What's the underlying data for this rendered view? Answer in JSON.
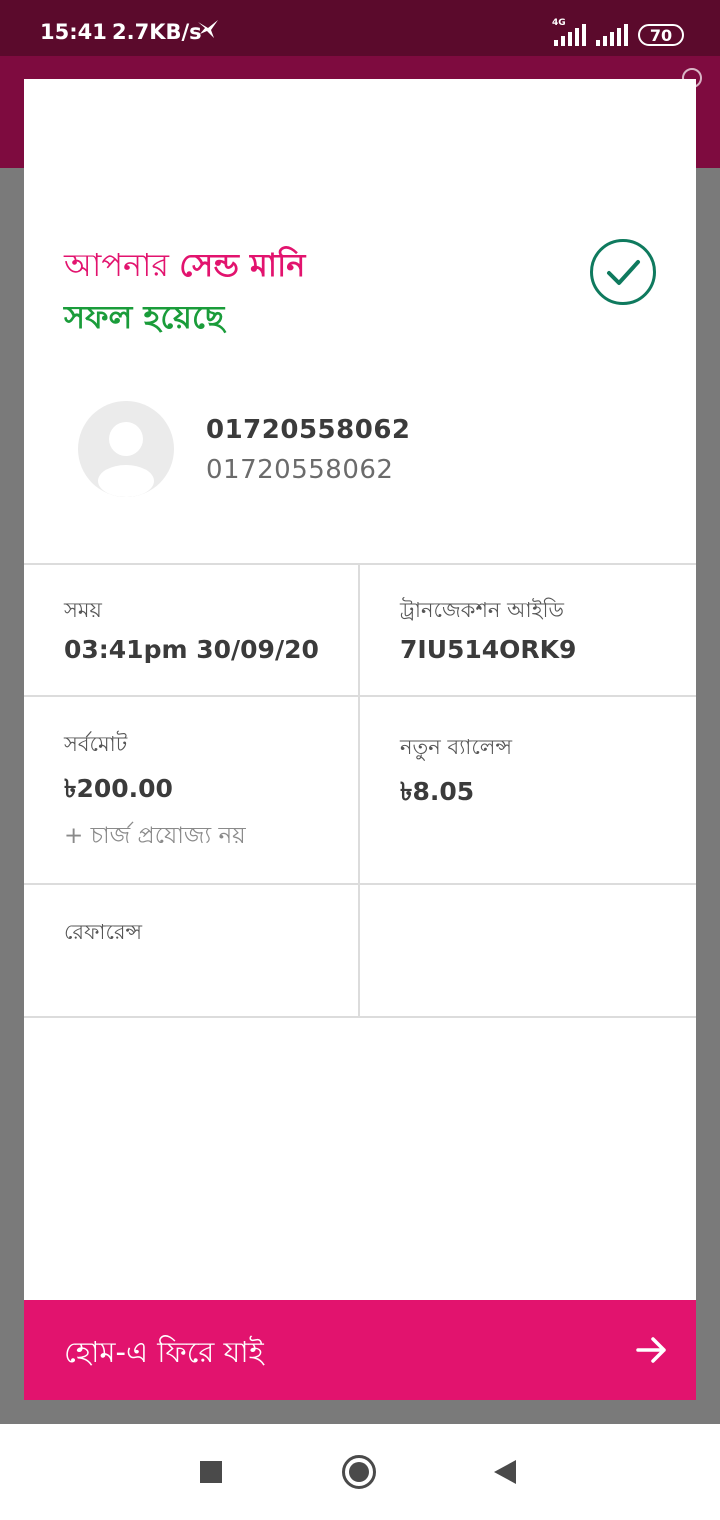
{
  "status_bar": {
    "time": "15:41",
    "speed": "2.7KB/s",
    "network_label": "4G",
    "battery": "70"
  },
  "colors": {
    "accent": "#e2136e",
    "success": "#1a9c3a",
    "check": "#0f7a5e",
    "status_bar_bg": "#5b0a2c",
    "app_bar_bg": "#7e0b3f"
  },
  "result": {
    "title_prefix": "আপনার ",
    "title_highlight": "সেন্ড মানি",
    "title_success": "সফল হয়েছে",
    "icon": "check-circle-icon"
  },
  "recipient": {
    "name": "01720558062",
    "number": "01720558062"
  },
  "details": {
    "time_label": "সময়",
    "time_value": "03:41pm 30/09/20",
    "txn_label": "ট্রানজেকশন আইডি",
    "txn_value": "7IU514ORK9",
    "total_label": "সর্বমোট",
    "total_value": "৳200.00",
    "charge_note": "+ চার্জ প্রযোজ্য নয়",
    "balance_label": "নতুন ব্যালেন্স",
    "balance_value": "৳8.05",
    "reference_label": "রেফারেন্স"
  },
  "home_button": {
    "label": "হোম-এ ফিরে যাই",
    "icon": "arrow-right-icon"
  },
  "nav": {
    "recents": "recents-square-icon",
    "home": "home-circle-icon",
    "back": "back-triangle-icon"
  }
}
